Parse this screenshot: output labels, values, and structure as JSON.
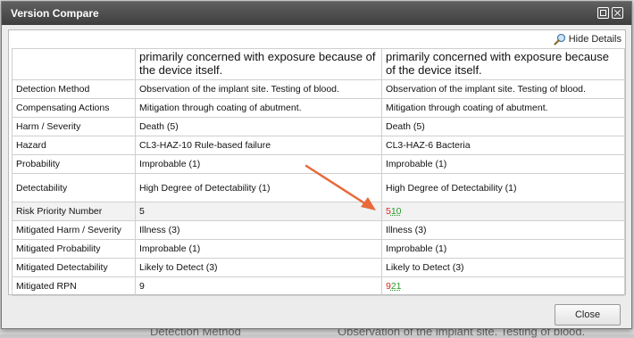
{
  "window": {
    "title": "Version Compare"
  },
  "toolbar": {
    "hide_details_label": "Hide Details"
  },
  "background": {
    "text_left": "Detection Method",
    "text_right": "Observation of the implant site. Testing of blood."
  },
  "compare": {
    "top_row": {
      "label": "",
      "left": "primarily concerned with exposure because of the device itself.",
      "right": "primarily concerned with exposure because of the device itself."
    },
    "rows": [
      {
        "label": "Detection Method",
        "left": "Observation of the implant site. Testing of blood.",
        "right": "Observation of the implant site. Testing of blood."
      },
      {
        "label": "Compensating Actions",
        "left": "Mitigation through coating of abutment.",
        "right": "Mitigation through coating of abutment."
      },
      {
        "label": "Harm / Severity",
        "left": "Death (5)",
        "right": "Death (5)"
      },
      {
        "label": "Hazard",
        "left": "CL3-HAZ-10 Rule-based failure",
        "right": "CL3-HAZ-6 Bacteria"
      },
      {
        "label": "Probability",
        "left": "Improbable (1)",
        "right": "Improbable (1)"
      },
      {
        "label": "Detectability",
        "left": "High Degree of Detectability (1)",
        "right": "High Degree of Detectability (1)"
      },
      {
        "label": "Risk Priority Number",
        "left": "5",
        "right_deleted": "5",
        "right_inserted": "10"
      },
      {
        "label": "Mitigated Harm / Severity",
        "left": "Illness (3)",
        "right": "Illness (3)"
      },
      {
        "label": "Mitigated Probability",
        "left": "Improbable (1)",
        "right": "Improbable (1)"
      },
      {
        "label": "Mitigated Detectability",
        "left": "Likely to Detect (3)",
        "right": "Likely to Detect (3)"
      },
      {
        "label": "Mitigated RPN",
        "left": "9",
        "right_deleted": "9",
        "right_inserted": "21"
      }
    ]
  },
  "footer": {
    "close_label": "Close"
  },
  "colors": {
    "link": "#2b8bb0",
    "deleted": "#dd2222",
    "inserted": "#2a9a2a",
    "arrow": "#e8693a",
    "titlebar": "#4a4a4a"
  }
}
